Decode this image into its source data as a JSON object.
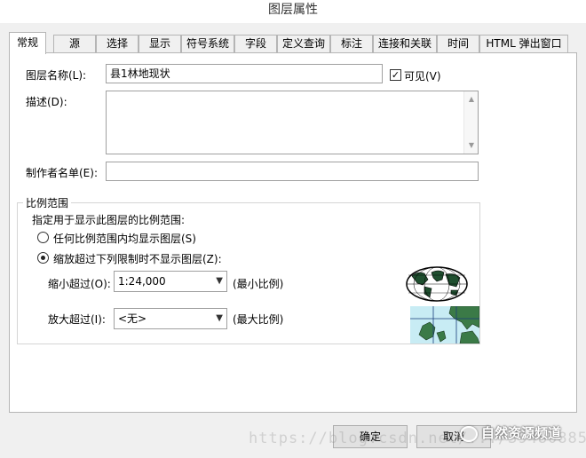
{
  "window": {
    "title": "图层属性",
    "close_glyph": "✕"
  },
  "tabs": [
    {
      "label": "常规",
      "active": true
    },
    {
      "label": "源"
    },
    {
      "label": "选择"
    },
    {
      "label": "显示"
    },
    {
      "label": "符号系统"
    },
    {
      "label": "字段"
    },
    {
      "label": "定义查询"
    },
    {
      "label": "标注"
    },
    {
      "label": "连接和关联"
    },
    {
      "label": "时间"
    },
    {
      "label": "HTML 弹出窗口"
    }
  ],
  "general": {
    "layer_name_label": "图层名称(L):",
    "layer_name_value": "县1林地现状",
    "visible_label": "可见(V)",
    "visible_checked": true,
    "description_label": "描述(D):",
    "description_value": "",
    "credits_label": "制作者名单(E):",
    "credits_value": ""
  },
  "scale_range": {
    "group_label": "比例范围",
    "instruction": "指定用于显示此图层的比例范围:",
    "option_any": "任何比例范围内均显示图层(S)",
    "option_limit": "缩放超过下列限制时不显示图层(Z):",
    "selected": "limit",
    "min_label": "缩小超过(O):",
    "min_value": "1:24,000",
    "min_hint": "(最小比例)",
    "max_label": "放大超过(I):",
    "max_value": "<无>",
    "max_hint": "(最大比例)"
  },
  "icons": {
    "globe": "globe-icon",
    "map": "map-icon",
    "checkbox_glyph": "✓",
    "dropdown_glyph": "▼",
    "scroll_up_glyph": "▲",
    "scroll_down_glyph": "▼"
  },
  "buttons": {
    "ok": "确定",
    "cancel": "取消"
  },
  "overlay": {
    "url_watermark": "https://blog.csdn.net/.../39480885",
    "brand_watermark": "自然资源频道"
  }
}
